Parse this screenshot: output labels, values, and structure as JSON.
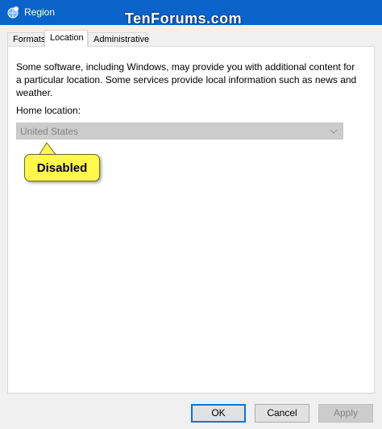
{
  "window": {
    "title": "Region",
    "watermark": "TenForums.com"
  },
  "tabs": [
    {
      "label": "Formats",
      "active": false
    },
    {
      "label": "Location",
      "active": true
    },
    {
      "label": "Administrative",
      "active": false
    }
  ],
  "location": {
    "description": "Some software, including Windows, may provide you with additional content for a particular location. Some services provide local information such as news and weather.",
    "home_label": "Home location:",
    "home_value": "United States",
    "home_disabled": true
  },
  "callout": {
    "text": "Disabled",
    "color": "#fff94a"
  },
  "buttons": {
    "ok": "OK",
    "cancel": "Cancel",
    "apply": "Apply"
  },
  "icons": {
    "window": "region-globe-icon",
    "dropdown": "chevron-down-icon"
  },
  "colors": {
    "titlebar": "#0a63c8",
    "accent": "#0078d7"
  }
}
